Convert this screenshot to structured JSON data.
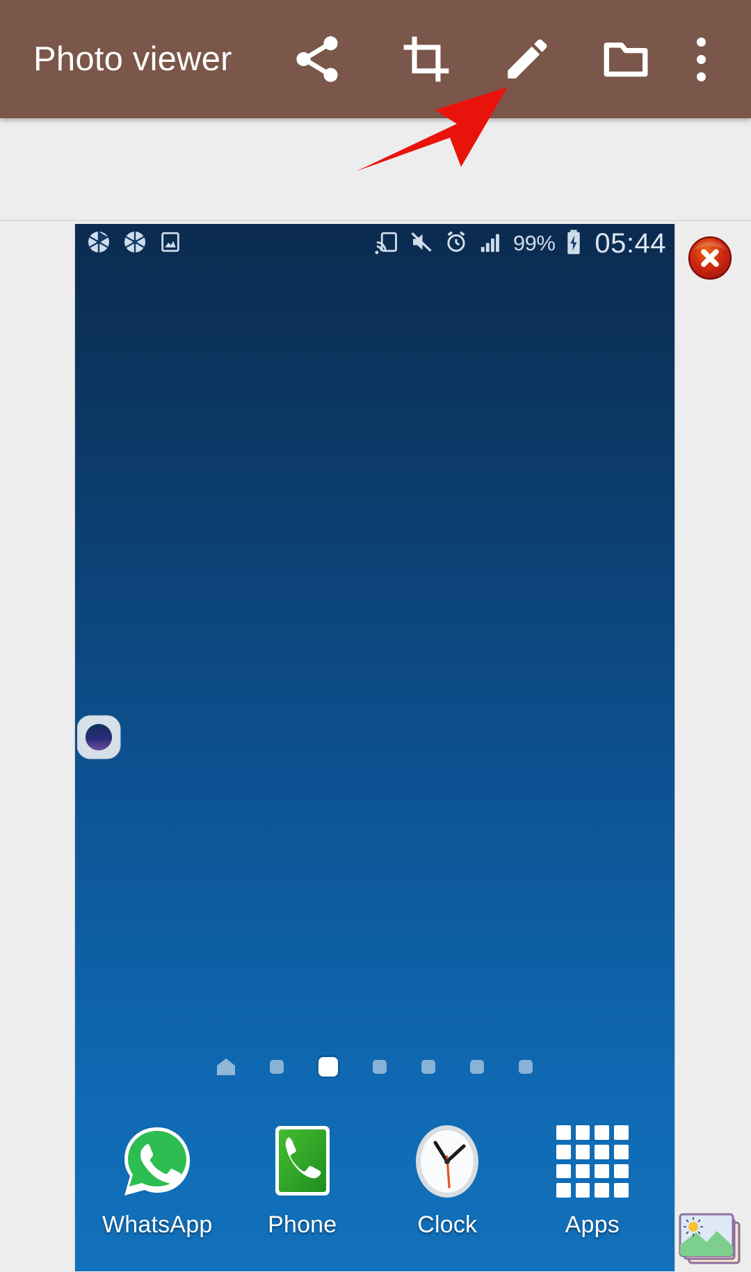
{
  "app": {
    "title": "Photo viewer",
    "toolbar_color": "#7a574a",
    "title_color": "#ffffff",
    "actions": [
      {
        "id": "share",
        "icon": "share-icon",
        "label": "Share"
      },
      {
        "id": "crop",
        "icon": "crop-icon",
        "label": "Crop"
      },
      {
        "id": "edit",
        "icon": "pencil-edit-icon",
        "label": "Edit"
      },
      {
        "id": "folder",
        "icon": "folder-icon",
        "label": "Open folder"
      },
      {
        "id": "more",
        "icon": "overflow-menu-icon",
        "label": "More options"
      }
    ]
  },
  "annotation": {
    "type": "arrow",
    "color": "#e8140c",
    "points_to": "edit",
    "direction": "up-right"
  },
  "close_button": {
    "icon": "close-icon",
    "label": "Close",
    "color": "#c42316"
  },
  "gallery_thumb": {
    "icon": "gallery-photos-icon",
    "label": "Gallery"
  },
  "screenshot": {
    "status_bar": {
      "left_icons": [
        {
          "icon": "aperture-icon",
          "label": "Camera"
        },
        {
          "icon": "aperture-icon",
          "label": "Camera"
        },
        {
          "icon": "screenshot-icon",
          "label": "Screenshot captured"
        }
      ],
      "right_icons": [
        {
          "icon": "cast-screen-icon",
          "label": "Screen mirroring"
        },
        {
          "icon": "mute-icon",
          "label": "Sound off"
        },
        {
          "icon": "alarm-clock-icon",
          "label": "Alarm set"
        },
        {
          "icon": "signal-bars-icon",
          "label": "Signal strength"
        }
      ],
      "battery_percent": "99%",
      "battery_icon": "battery-charging-icon",
      "clock": "05:44"
    },
    "wallpaper": {
      "gradient_top": "#0b2b4f",
      "gradient_bottom": "#1271bb"
    },
    "home_icons": [
      {
        "icon": "camera-app-icon",
        "label": "Camera"
      }
    ],
    "page_indicators": {
      "count": 7,
      "active_index": 2,
      "home_index": 0
    },
    "dock": [
      {
        "icon": "whatsapp-icon",
        "label": "WhatsApp"
      },
      {
        "icon": "phone-icon",
        "label": "Phone"
      },
      {
        "icon": "clock-icon",
        "label": "Clock"
      },
      {
        "icon": "apps-grid-icon",
        "label": "Apps"
      }
    ]
  }
}
